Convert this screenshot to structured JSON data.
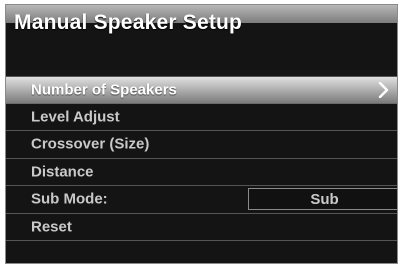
{
  "screen": {
    "title": "Manual Speaker Setup"
  },
  "menu": {
    "items": [
      {
        "label": "Number of Speakers",
        "selected": true,
        "icon": "chevron-right-icon"
      },
      {
        "label": "Level Adjust"
      },
      {
        "label": "Crossover (Size)"
      },
      {
        "label": "Distance"
      },
      {
        "label": "Sub Mode:",
        "value": "Sub"
      },
      {
        "label": "Reset"
      }
    ]
  },
  "colors": {
    "background": "#141414",
    "text": "#c9c9c9",
    "selected_text": "#ffffff",
    "highlight_top": "#e0e0e0",
    "highlight_bottom": "#7b7b7b"
  }
}
